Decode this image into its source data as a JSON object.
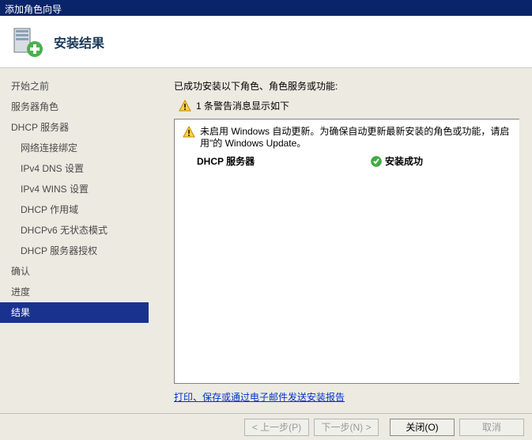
{
  "window": {
    "title": "添加角色向导"
  },
  "header": {
    "title": "安装结果"
  },
  "sidebar": {
    "items": [
      {
        "label": "开始之前",
        "sub": false
      },
      {
        "label": "服务器角色",
        "sub": false
      },
      {
        "label": "DHCP 服务器",
        "sub": false
      },
      {
        "label": "网络连接绑定",
        "sub": true
      },
      {
        "label": "IPv4 DNS 设置",
        "sub": true
      },
      {
        "label": "IPv4 WINS 设置",
        "sub": true
      },
      {
        "label": "DHCP 作用域",
        "sub": true
      },
      {
        "label": "DHCPv6 无状态模式",
        "sub": true
      },
      {
        "label": "DHCP 服务器授权",
        "sub": true
      },
      {
        "label": "确认",
        "sub": false
      },
      {
        "label": "进度",
        "sub": false
      },
      {
        "label": "结果",
        "sub": false
      }
    ],
    "activeIndex": 11
  },
  "main": {
    "intro": "已成功安装以下角色、角色服务或功能:",
    "warn_summary": "1 条警告消息显示如下",
    "inner_warning": "未启用 Windows 自动更新。为确保自动更新最新安装的角色或功能，请启用\"的 Windows Update。",
    "role_name": "DHCP 服务器",
    "role_status": "安装成功",
    "report_link": "打印、保存或通过电子邮件发送安装报告"
  },
  "footer": {
    "prev": "< 上一步(P)",
    "next": "下一步(N) >",
    "close": "关闭(O)",
    "cancel": "取消"
  },
  "icons": {
    "warn": "warning-icon",
    "ok": "success-icon",
    "header": "server-add-icon"
  }
}
